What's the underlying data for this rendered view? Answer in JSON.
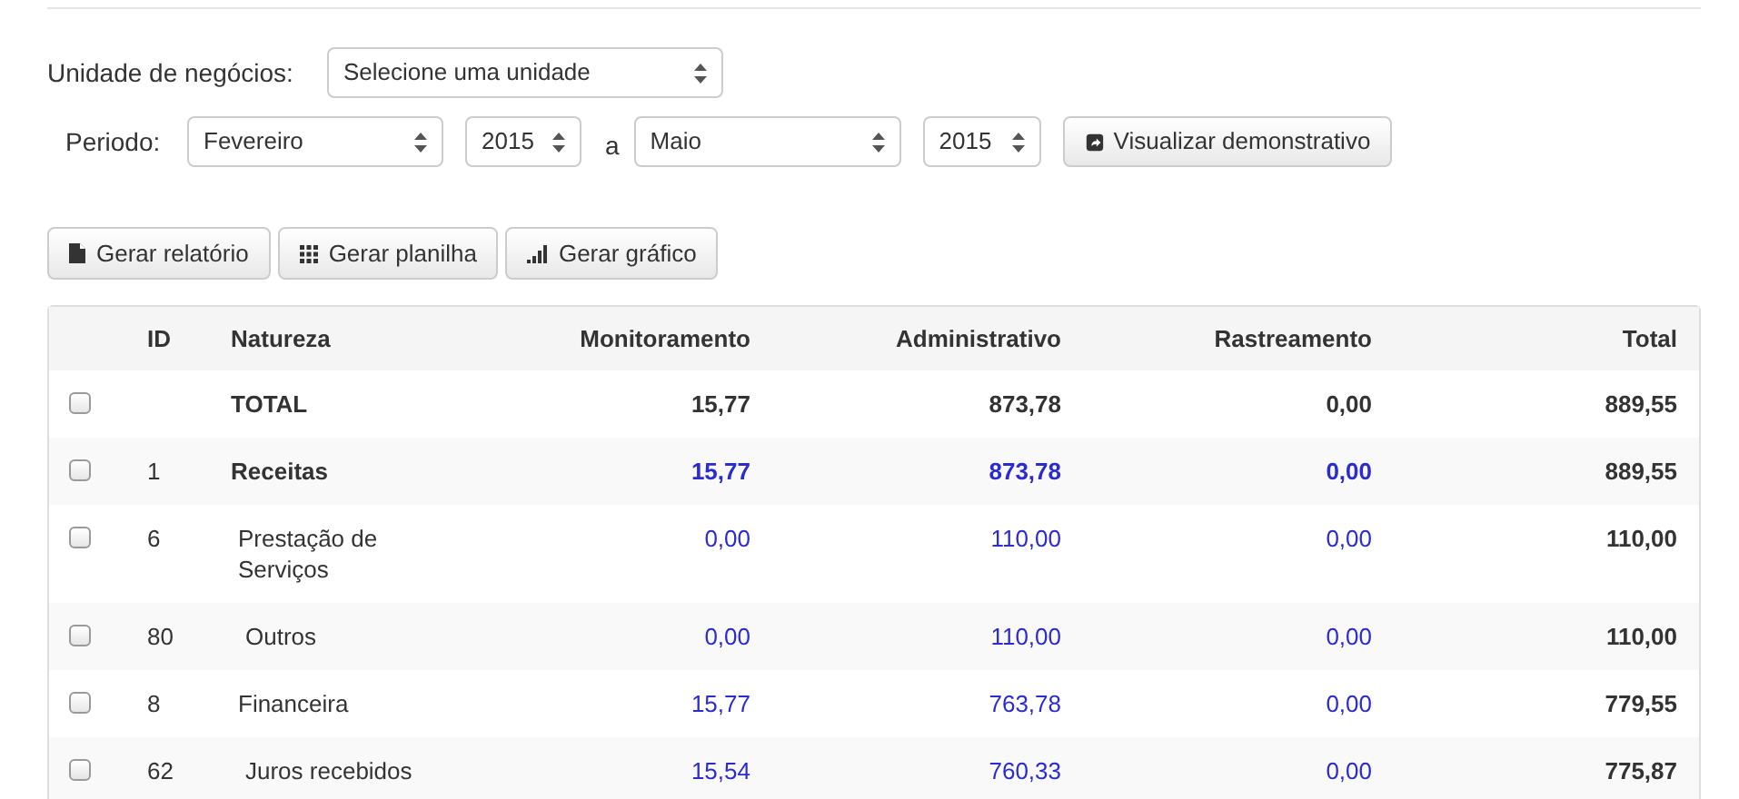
{
  "filters": {
    "unit_label": "Unidade de negócios:",
    "unit_select": "Selecione uma unidade",
    "period_label": "Periodo:",
    "from_month": "Fevereiro",
    "from_year": "2015",
    "separator": "a",
    "to_month": "Maio",
    "to_year": "2015",
    "view_button": "Visualizar demonstrativo"
  },
  "actions": [
    {
      "kind": "report",
      "label": "Gerar relatório"
    },
    {
      "kind": "sheet",
      "label": "Gerar planilha"
    },
    {
      "kind": "chart",
      "label": "Gerar gráfico"
    }
  ],
  "table": {
    "columns": [
      "ID",
      "Natureza",
      "Monitoramento",
      "Administrativo",
      "Rastreamento",
      "Total"
    ],
    "rows": [
      {
        "kind": "total",
        "checked": false,
        "id": "",
        "nature": "TOTAL",
        "values": [
          "15,77",
          "873,78",
          "0,00",
          "889,55"
        ],
        "children": [
          {
            "kind": "group",
            "checked": false,
            "id": "1",
            "nature": "Receitas",
            "values": [
              "15,77",
              "873,78",
              "0,00",
              "889,55"
            ],
            "children": [
              {
                "kind": "item",
                "checked": false,
                "id": "6",
                "nature": "Prestação de Serviços",
                "values": [
                  "0,00",
                  "110,00",
                  "0,00",
                  "110,00"
                ],
                "children": [
                  {
                    "kind": "item",
                    "checked": false,
                    "id": "80",
                    "nature": "Outros",
                    "values": [
                      "0,00",
                      "110,00",
                      "0,00",
                      "110,00"
                    ]
                  }
                ]
              },
              {
                "kind": "item",
                "checked": false,
                "id": "8",
                "nature": "Financeira",
                "values": [
                  "15,77",
                  "763,78",
                  "0,00",
                  "779,55"
                ],
                "children": [
                  {
                    "kind": "item",
                    "checked": false,
                    "id": "62",
                    "nature": "Juros recebidos",
                    "values": [
                      "15,54",
                      "760,33",
                      "0,00",
                      "775,87"
                    ]
                  }
                ]
              }
            ]
          }
        ]
      }
    ]
  }
}
